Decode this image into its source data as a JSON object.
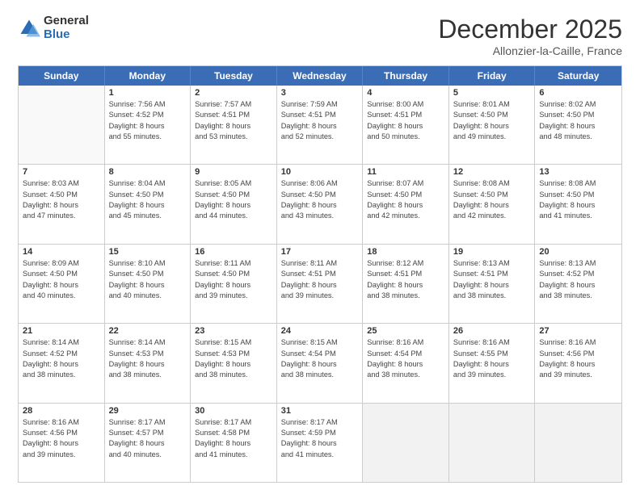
{
  "logo": {
    "general": "General",
    "blue": "Blue"
  },
  "header": {
    "month": "December 2025",
    "location": "Allonzier-la-Caille, France"
  },
  "weekdays": [
    "Sunday",
    "Monday",
    "Tuesday",
    "Wednesday",
    "Thursday",
    "Friday",
    "Saturday"
  ],
  "weeks": [
    [
      {
        "day": "",
        "lines": [],
        "empty": true
      },
      {
        "day": "1",
        "lines": [
          "Sunrise: 7:56 AM",
          "Sunset: 4:52 PM",
          "Daylight: 8 hours",
          "and 55 minutes."
        ]
      },
      {
        "day": "2",
        "lines": [
          "Sunrise: 7:57 AM",
          "Sunset: 4:51 PM",
          "Daylight: 8 hours",
          "and 53 minutes."
        ]
      },
      {
        "day": "3",
        "lines": [
          "Sunrise: 7:59 AM",
          "Sunset: 4:51 PM",
          "Daylight: 8 hours",
          "and 52 minutes."
        ]
      },
      {
        "day": "4",
        "lines": [
          "Sunrise: 8:00 AM",
          "Sunset: 4:51 PM",
          "Daylight: 8 hours",
          "and 50 minutes."
        ]
      },
      {
        "day": "5",
        "lines": [
          "Sunrise: 8:01 AM",
          "Sunset: 4:50 PM",
          "Daylight: 8 hours",
          "and 49 minutes."
        ]
      },
      {
        "day": "6",
        "lines": [
          "Sunrise: 8:02 AM",
          "Sunset: 4:50 PM",
          "Daylight: 8 hours",
          "and 48 minutes."
        ]
      }
    ],
    [
      {
        "day": "7",
        "lines": [
          "Sunrise: 8:03 AM",
          "Sunset: 4:50 PM",
          "Daylight: 8 hours",
          "and 47 minutes."
        ]
      },
      {
        "day": "8",
        "lines": [
          "Sunrise: 8:04 AM",
          "Sunset: 4:50 PM",
          "Daylight: 8 hours",
          "and 45 minutes."
        ]
      },
      {
        "day": "9",
        "lines": [
          "Sunrise: 8:05 AM",
          "Sunset: 4:50 PM",
          "Daylight: 8 hours",
          "and 44 minutes."
        ]
      },
      {
        "day": "10",
        "lines": [
          "Sunrise: 8:06 AM",
          "Sunset: 4:50 PM",
          "Daylight: 8 hours",
          "and 43 minutes."
        ]
      },
      {
        "day": "11",
        "lines": [
          "Sunrise: 8:07 AM",
          "Sunset: 4:50 PM",
          "Daylight: 8 hours",
          "and 42 minutes."
        ]
      },
      {
        "day": "12",
        "lines": [
          "Sunrise: 8:08 AM",
          "Sunset: 4:50 PM",
          "Daylight: 8 hours",
          "and 42 minutes."
        ]
      },
      {
        "day": "13",
        "lines": [
          "Sunrise: 8:08 AM",
          "Sunset: 4:50 PM",
          "Daylight: 8 hours",
          "and 41 minutes."
        ]
      }
    ],
    [
      {
        "day": "14",
        "lines": [
          "Sunrise: 8:09 AM",
          "Sunset: 4:50 PM",
          "Daylight: 8 hours",
          "and 40 minutes."
        ]
      },
      {
        "day": "15",
        "lines": [
          "Sunrise: 8:10 AM",
          "Sunset: 4:50 PM",
          "Daylight: 8 hours",
          "and 40 minutes."
        ]
      },
      {
        "day": "16",
        "lines": [
          "Sunrise: 8:11 AM",
          "Sunset: 4:50 PM",
          "Daylight: 8 hours",
          "and 39 minutes."
        ]
      },
      {
        "day": "17",
        "lines": [
          "Sunrise: 8:11 AM",
          "Sunset: 4:51 PM",
          "Daylight: 8 hours",
          "and 39 minutes."
        ]
      },
      {
        "day": "18",
        "lines": [
          "Sunrise: 8:12 AM",
          "Sunset: 4:51 PM",
          "Daylight: 8 hours",
          "and 38 minutes."
        ]
      },
      {
        "day": "19",
        "lines": [
          "Sunrise: 8:13 AM",
          "Sunset: 4:51 PM",
          "Daylight: 8 hours",
          "and 38 minutes."
        ]
      },
      {
        "day": "20",
        "lines": [
          "Sunrise: 8:13 AM",
          "Sunset: 4:52 PM",
          "Daylight: 8 hours",
          "and 38 minutes."
        ]
      }
    ],
    [
      {
        "day": "21",
        "lines": [
          "Sunrise: 8:14 AM",
          "Sunset: 4:52 PM",
          "Daylight: 8 hours",
          "and 38 minutes."
        ]
      },
      {
        "day": "22",
        "lines": [
          "Sunrise: 8:14 AM",
          "Sunset: 4:53 PM",
          "Daylight: 8 hours",
          "and 38 minutes."
        ]
      },
      {
        "day": "23",
        "lines": [
          "Sunrise: 8:15 AM",
          "Sunset: 4:53 PM",
          "Daylight: 8 hours",
          "and 38 minutes."
        ]
      },
      {
        "day": "24",
        "lines": [
          "Sunrise: 8:15 AM",
          "Sunset: 4:54 PM",
          "Daylight: 8 hours",
          "and 38 minutes."
        ]
      },
      {
        "day": "25",
        "lines": [
          "Sunrise: 8:16 AM",
          "Sunset: 4:54 PM",
          "Daylight: 8 hours",
          "and 38 minutes."
        ]
      },
      {
        "day": "26",
        "lines": [
          "Sunrise: 8:16 AM",
          "Sunset: 4:55 PM",
          "Daylight: 8 hours",
          "and 39 minutes."
        ]
      },
      {
        "day": "27",
        "lines": [
          "Sunrise: 8:16 AM",
          "Sunset: 4:56 PM",
          "Daylight: 8 hours",
          "and 39 minutes."
        ]
      }
    ],
    [
      {
        "day": "28",
        "lines": [
          "Sunrise: 8:16 AM",
          "Sunset: 4:56 PM",
          "Daylight: 8 hours",
          "and 39 minutes."
        ]
      },
      {
        "day": "29",
        "lines": [
          "Sunrise: 8:17 AM",
          "Sunset: 4:57 PM",
          "Daylight: 8 hours",
          "and 40 minutes."
        ]
      },
      {
        "day": "30",
        "lines": [
          "Sunrise: 8:17 AM",
          "Sunset: 4:58 PM",
          "Daylight: 8 hours",
          "and 41 minutes."
        ]
      },
      {
        "day": "31",
        "lines": [
          "Sunrise: 8:17 AM",
          "Sunset: 4:59 PM",
          "Daylight: 8 hours",
          "and 41 minutes."
        ]
      },
      {
        "day": "",
        "lines": [],
        "empty": true
      },
      {
        "day": "",
        "lines": [],
        "empty": true
      },
      {
        "day": "",
        "lines": [],
        "empty": true
      }
    ]
  ]
}
